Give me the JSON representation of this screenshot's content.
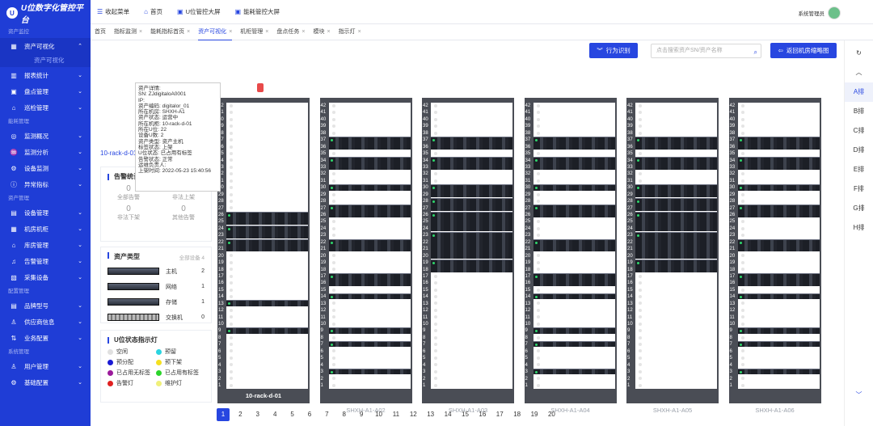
{
  "app": {
    "logo": "U",
    "title": "U位数字化管控平台"
  },
  "sidebar": [
    {
      "type": "sec",
      "label": "资产监控"
    },
    {
      "type": "item",
      "label": "资产可视化",
      "icon": "▦",
      "act": true,
      "open": true
    },
    {
      "type": "sub",
      "label": "资产可视化"
    },
    {
      "type": "item",
      "label": "报表统计",
      "icon": "▥"
    },
    {
      "type": "item",
      "label": "盘点管理",
      "icon": "▣"
    },
    {
      "type": "item",
      "label": "巡检管理",
      "icon": "⌂"
    },
    {
      "type": "sec",
      "label": "能耗管理"
    },
    {
      "type": "item",
      "label": "监测概况",
      "icon": "◎"
    },
    {
      "type": "item",
      "label": "监测分析",
      "icon": "♒"
    },
    {
      "type": "item",
      "label": "设备监测",
      "icon": "⚙"
    },
    {
      "type": "item",
      "label": "异常指标",
      "icon": "ⓘ"
    },
    {
      "type": "sec",
      "label": "资产管理"
    },
    {
      "type": "item",
      "label": "设备管理",
      "icon": "▤"
    },
    {
      "type": "item",
      "label": "机房机柜",
      "icon": "▦"
    },
    {
      "type": "item",
      "label": "库房管理",
      "icon": "⌂"
    },
    {
      "type": "item",
      "label": "告警管理",
      "icon": "♫"
    },
    {
      "type": "item",
      "label": "采集设备",
      "icon": "▧"
    },
    {
      "type": "sec",
      "label": "配置管理"
    },
    {
      "type": "item",
      "label": "品牌型号",
      "icon": "▤"
    },
    {
      "type": "item",
      "label": "供应商信息",
      "icon": "♙"
    },
    {
      "type": "item",
      "label": "业务配置",
      "icon": "⇅"
    },
    {
      "type": "sec",
      "label": "系统管理"
    },
    {
      "type": "item",
      "label": "用户管理",
      "icon": "♙"
    },
    {
      "type": "item",
      "label": "基础配置",
      "icon": "⚙"
    }
  ],
  "topbar": {
    "collapse": "收起菜单",
    "home": "首页",
    "u_screen": "U位管控大屏",
    "energy_screen": "能耗管控大屏",
    "user": "系统管理员"
  },
  "tabs": [
    "首页",
    "指标监测",
    "能耗指标首页",
    "资产可视化",
    "机柜管理",
    "盘点任务",
    "模块",
    "指示灯"
  ],
  "toolbar": {
    "action": "行为识别",
    "search_placeholder": "点击搜索资产SN/资产名称",
    "back": "返回机房缩略图"
  },
  "rack_title": "10-rack-d-01 机柜详情",
  "alarm": {
    "title": "告警统计",
    "items": [
      {
        "n": "0",
        "l": "全部告警"
      },
      {
        "n": "0",
        "l": "非法上架"
      },
      {
        "n": "0",
        "l": "非法下架"
      },
      {
        "n": "0",
        "l": "其他告警"
      }
    ]
  },
  "asset_types": {
    "title": "资产类型",
    "all": "全部设备 4",
    "items": [
      {
        "l": "主机",
        "n": "2"
      },
      {
        "l": "网络",
        "n": "1"
      },
      {
        "l": "存储",
        "n": "1"
      },
      {
        "l": "交换机",
        "n": "0"
      }
    ]
  },
  "u_legend": {
    "title": "U位状态指示灯",
    "items": [
      {
        "l": "空闲",
        "c": "#e0e0e0"
      },
      {
        "l": "预留",
        "c": "#2bd4e0"
      },
      {
        "l": "预分配",
        "c": "#1a1ad4"
      },
      {
        "l": "预下架",
        "c": "#f5e020"
      },
      {
        "l": "已占用无标签",
        "c": "#9b1a9b"
      },
      {
        "l": "已占用有标签",
        "c": "#2bd42b"
      },
      {
        "l": "告警灯",
        "c": "#e02020"
      },
      {
        "l": "维护灯",
        "c": "#f0f07a"
      }
    ]
  },
  "tooltip": [
    "资产详情:",
    "SN: ZJdigitaloA0001",
    "IP:",
    "资产编码: digitalor_01",
    "所在机房: SHXH-A1",
    "资产状态: 运营中",
    "所在机柜: 10-rack-d-01",
    "所在U位: 22",
    "设备U数: 2",
    "资产类型: 资产主机",
    "标签状态: 上架",
    "U位状态: 已占用有标签",
    "告警状态: 正常",
    "运维负责人:",
    "上架时间: 2022-05-23 15:40:56"
  ],
  "racks": [
    "10-rack-d-01",
    "SHXH-A1-A02",
    "SHXH-A1-A03",
    "SHXH-A1-A04",
    "SHXH-A1-A05",
    "SHXH-A1-A06"
  ],
  "rows": [
    "A排",
    "B排",
    "C排",
    "D排",
    "E排",
    "F排",
    "G排",
    "H排"
  ],
  "pages": [
    "1",
    "2",
    "3",
    "4",
    "5",
    "6",
    "7",
    "8",
    "9",
    "10",
    "11",
    "12",
    "13",
    "14",
    "15",
    "16",
    "17",
    "18",
    "19",
    "20"
  ]
}
